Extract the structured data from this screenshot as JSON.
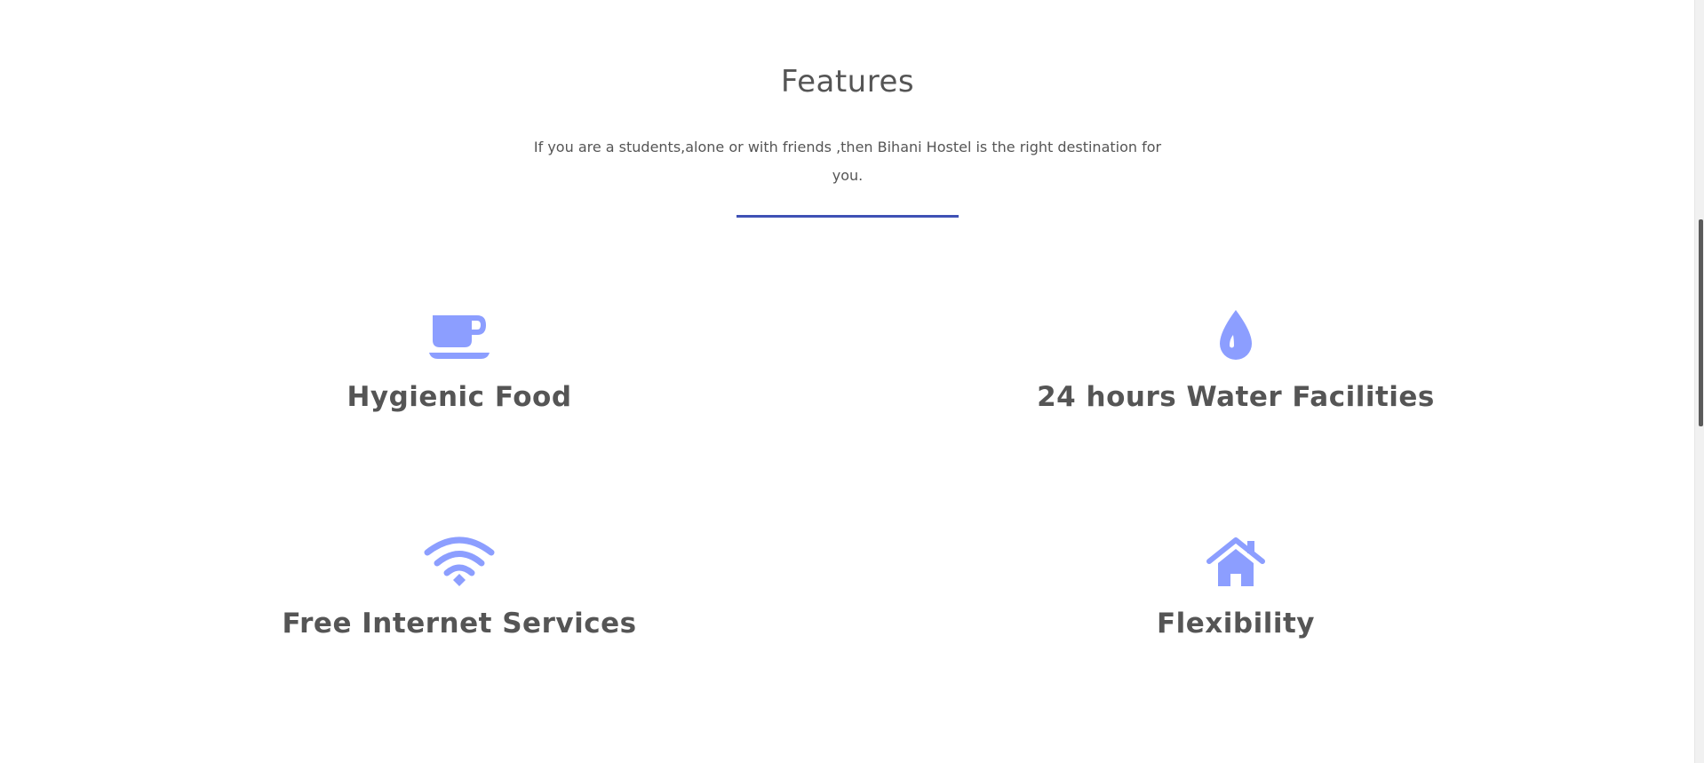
{
  "features_section": {
    "title": "Features",
    "subtitle": "If you are a students,alone or with friends ,then Bihani Hostel is the right destination for you.",
    "accent_color": "#3f51b5",
    "icon_color": "#8c9eff",
    "items": [
      {
        "icon": "coffee-cup-icon",
        "label": "Hygienic Food"
      },
      {
        "icon": "water-drop-icon",
        "label": "24 hours Water Facilities"
      },
      {
        "icon": "wifi-icon",
        "label": "Free Internet Services"
      },
      {
        "icon": "home-icon",
        "label": "Flexibility"
      }
    ]
  }
}
